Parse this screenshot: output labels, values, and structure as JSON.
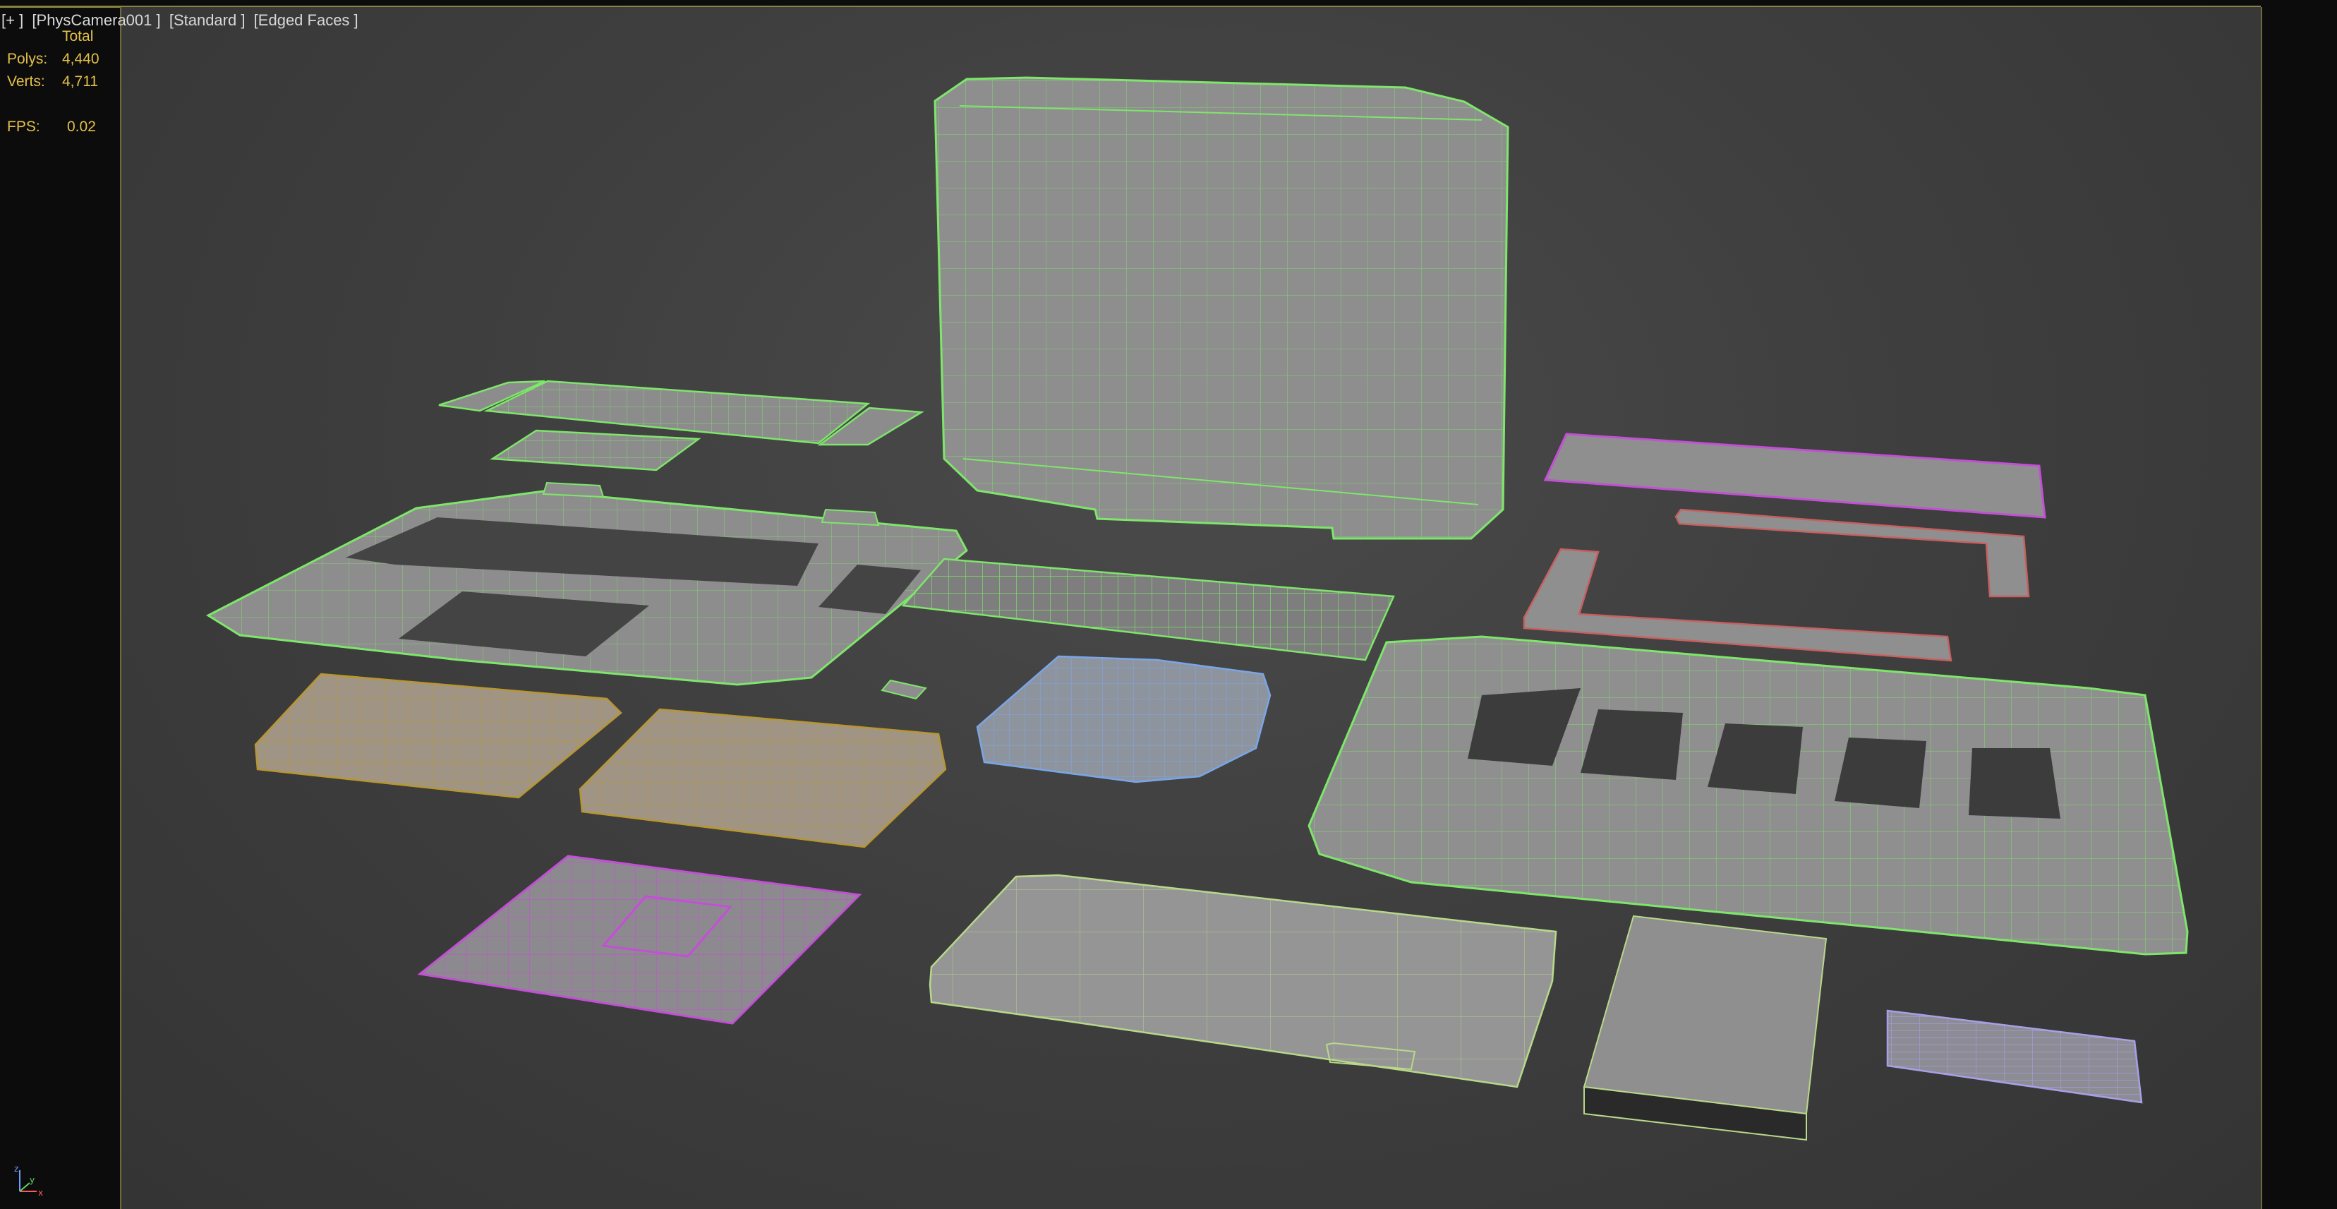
{
  "viewport": {
    "label": "[+ ]  [PhysCamera001 ]  [Standard ]  [Edged Faces ]"
  },
  "stats": {
    "total_label": "Total",
    "polys_label": "Polys:",
    "polys_value": "4,440",
    "verts_label": "Verts:",
    "verts_value": "4,711",
    "fps_label": "FPS:",
    "fps_value": "0.02"
  },
  "gizmo": {
    "x_label": "x",
    "y_label": "y",
    "z_label": "z"
  },
  "colors": {
    "wire_green": "#7ee66a",
    "wire_magenta": "#c34fd6",
    "wire_gold": "#b8962f",
    "wire_blue": "#7aa6e8",
    "wire_lavender": "#a7a0e6",
    "stats_text": "#e3c14a",
    "mesh_fill": "#8f8f8f"
  }
}
